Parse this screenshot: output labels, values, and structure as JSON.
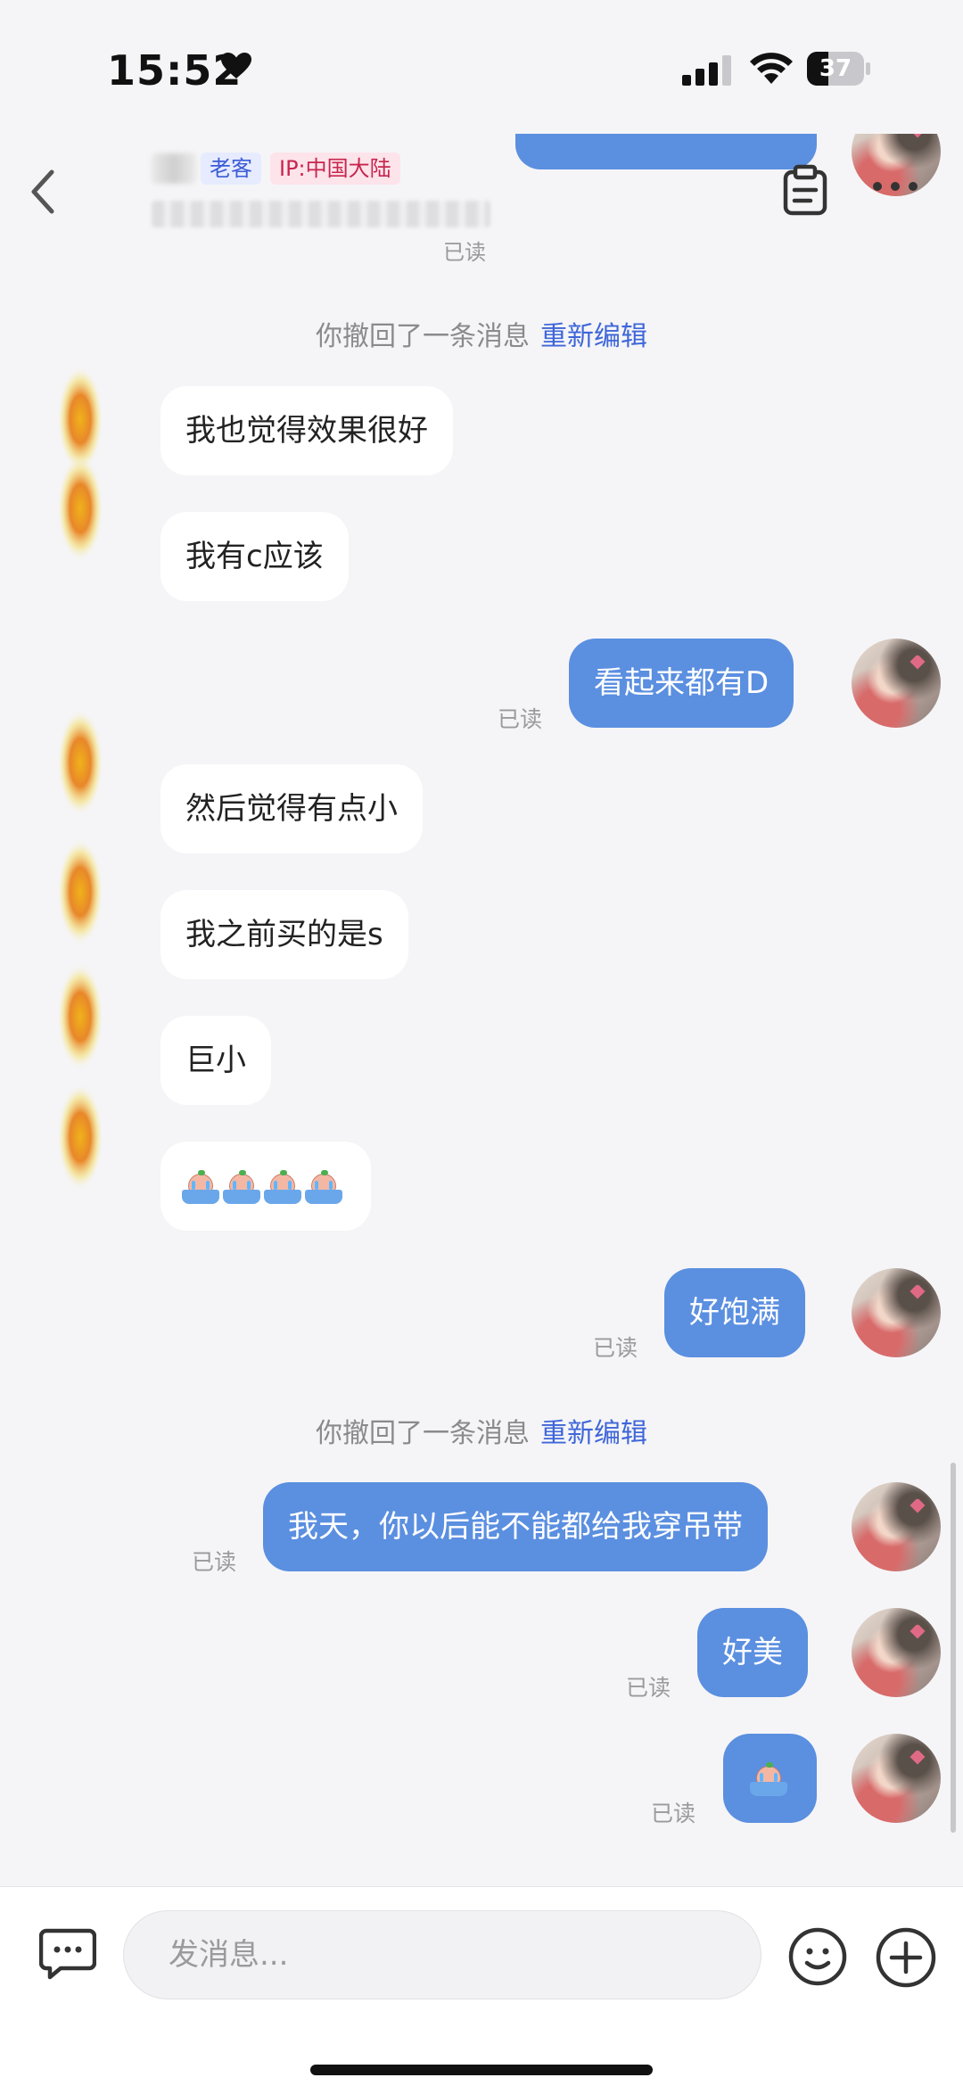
{
  "status_bar": {
    "time": "15:52",
    "battery_percent": "37",
    "battery_level": 0.37
  },
  "header": {
    "tags": [
      "老客",
      "IP:中国大陆"
    ],
    "icons": [
      "back-arrow-icon",
      "clipboard-icon",
      "more-icon"
    ]
  },
  "chat": {
    "messages": [
      {
        "type": "read",
        "text": "已读"
      },
      {
        "type": "system",
        "text": "你撤回了一条消息",
        "action": "重新编辑"
      },
      {
        "type": "incoming",
        "text": "我也觉得效果很好"
      },
      {
        "type": "incoming",
        "text": "我有c应该"
      },
      {
        "type": "outgoing",
        "text": "看起来都有D",
        "status": "已读"
      },
      {
        "type": "incoming",
        "text": "然后觉得有点小"
      },
      {
        "type": "incoming",
        "text": "我之前买的是s"
      },
      {
        "type": "incoming",
        "text": "巨小"
      },
      {
        "type": "incoming",
        "sticker": "crying-bath-emoji",
        "count": 4
      },
      {
        "type": "outgoing",
        "text": "好饱满",
        "status": "已读"
      },
      {
        "type": "system",
        "text": "你撤回了一条消息",
        "action": "重新编辑"
      },
      {
        "type": "outgoing",
        "text": "我天，你以后能不能都给我穿吊带",
        "status": "已读"
      },
      {
        "type": "outgoing",
        "text": "好美",
        "status": "已读"
      },
      {
        "type": "outgoing",
        "sticker": "crying-bath-emoji",
        "count": 1,
        "status": "已读"
      }
    ]
  },
  "input": {
    "placeholder": "发消息..."
  }
}
